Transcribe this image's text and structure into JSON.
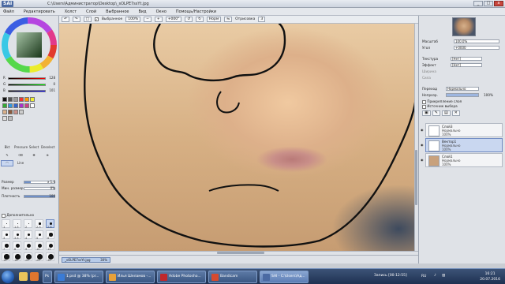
{
  "window": {
    "app_logo": "SAI",
    "title": "C:\\Users\\Администратор\\Desktop\\_sOLPE7ssYt.jpg"
  },
  "window_buttons": {
    "minimize": "_",
    "maximize": "□",
    "close": "x"
  },
  "menubar": [
    "Файл",
    "Редактировать",
    "Холст",
    "Слой",
    "Выбранное",
    "Вид",
    "Окно",
    "Помощь/Настройки"
  ],
  "toolbar": {
    "selection_label": "Выбранное",
    "zoom_value": "100%",
    "rotation_value": "+000°",
    "normal_label": "Норм",
    "stabilizer_label": "Отрисовка",
    "stabilizer_value": "3",
    "check_mark": "✓"
  },
  "left_panel": {
    "rgb_values": [
      "128",
      "0",
      "101"
    ],
    "colors": {
      "ring_top": "#e23a2d",
      "selected_color": "#1a1a1a"
    },
    "tools": [
      "Bkt",
      "Pressure",
      "Select",
      "Deselect",
      "Line"
    ],
    "properties": [
      {
        "label": "Размер",
        "value": "x 1.0",
        "fill": 0.2
      },
      {
        "label": "Мин. размер",
        "value": "0%",
        "fill": 0.0
      },
      {
        "label": "Плотность",
        "value": "100",
        "fill": 1.0
      }
    ],
    "extra_label": "Дополнительно",
    "brush_sizes": [
      "1",
      "1.5",
      "2",
      "2.3",
      "2.6",
      "3",
      "3.5",
      "4",
      "5",
      "6",
      "7",
      "8",
      "9",
      "10",
      "12",
      "14",
      "16",
      "20",
      "25",
      "30"
    ]
  },
  "canvas": {
    "background": "#e4c49f"
  },
  "document": {
    "name": "_sOLPE7ssYt.jpg",
    "zoom": "30%"
  },
  "right_panel": {
    "zoom_label": "Масштаб",
    "zoom_value": "100.0%",
    "angle_label": "Угол",
    "angle_value": "+0000",
    "texture_label": "Текстура",
    "texture_value": "[Нет]",
    "effect_label": "Эффект",
    "effect_value": "[Нет]",
    "width_label": "Ширина",
    "strength_label": "Сила",
    "mode_label": "Переход",
    "mode_value": "Нормально",
    "opacity_label": "Непрозр.",
    "opacity_value": "100%",
    "clip_label": "Прикрепление слоя",
    "source_label": "Источник выбора",
    "layers": [
      {
        "name": "Слой3",
        "mode": "Нормально",
        "opacity": "100%",
        "selected": false
      },
      {
        "name": "Вектор1",
        "mode": "Нормально",
        "opacity": "100%",
        "selected": true
      },
      {
        "name": "Слой1",
        "mode": "Нормально",
        "opacity": "100%",
        "selected": false
      }
    ]
  },
  "taskbar": {
    "tasks": [
      {
        "label": "Ps",
        "active": false,
        "color": "#2a5fa8"
      },
      {
        "label": "1.psd @ 38% (pr...",
        "active": false,
        "color": "#3a7bd5"
      },
      {
        "label": "Илья Шеламов -...",
        "active": false,
        "color": "#e7a13a"
      },
      {
        "label": "Adobe Photosho...",
        "active": false,
        "color": "#c0282d"
      },
      {
        "label": "Bandicam",
        "active": false,
        "color": "#d64a2e"
      },
      {
        "label": "SAI - C:\\Users\\Ад...",
        "active": true,
        "color": "#4b6aa3"
      }
    ],
    "recording": "Запись [00:12:55]",
    "lang": "RU",
    "time": "16:21",
    "date": "20.07.2016"
  }
}
